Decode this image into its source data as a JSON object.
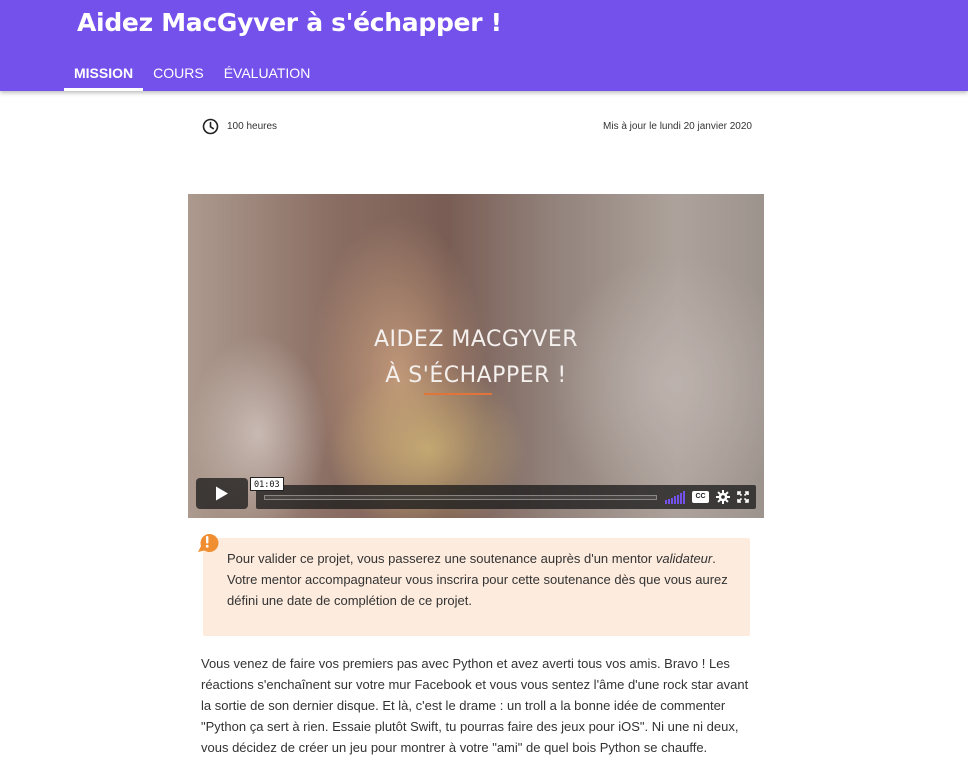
{
  "header": {
    "title": "Aidez MacGyver à s'échapper !",
    "tabs": [
      {
        "label": "MISSION",
        "active": true
      },
      {
        "label": "COURS",
        "active": false
      },
      {
        "label": "ÉVALUATION",
        "active": false
      }
    ],
    "background_color": "#7451eb"
  },
  "meta": {
    "duration": "100 heures",
    "updated": "Mis à jour le lundi 20 janvier 2020",
    "duration_icon": "clock-icon"
  },
  "video": {
    "title_line1": "AIDEZ MACGYVER",
    "title_line2": "À S'ÉCHAPPER !",
    "timestamp": "01:03",
    "progress_fraction": 0.0,
    "accent_color": "#7451eb",
    "icons": [
      "play-icon",
      "volume-icon",
      "closed-captions-icon",
      "gear-icon",
      "fullscreen-icon"
    ],
    "cc_label": "CC"
  },
  "notice": {
    "icon": "exclamation-icon",
    "line1": " Pour valider ce projet, vous passerez une soutenance auprès d'un mentor",
    "line1_em": "validateur",
    "line1_end": ".",
    "line2": "Votre mentor accompagnateur vous inscrira pour cette soutenance dès que vous aurez défini une date de complétion de ce projet.",
    "background_color": "#fdebdd",
    "icon_color": "#f08f32"
  },
  "body": {
    "paragraph": "Vous venez de faire vos premiers pas avec Python et avez averti tous vos amis. Bravo ! Les réactions s'enchaînent sur votre mur Facebook et vous vous sentez l'âme d'une rock star avant la sortie de son dernier disque. Et là, c'est le drame : un troll a la bonne idée de commenter \"Python ça sert à rien. Essaie plutôt Swift, tu pourras faire des jeux pour iOS\". Ni une ni deux, vous décidez de créer un jeu pour montrer à votre \"ami\" de quel bois Python se chauffe."
  }
}
